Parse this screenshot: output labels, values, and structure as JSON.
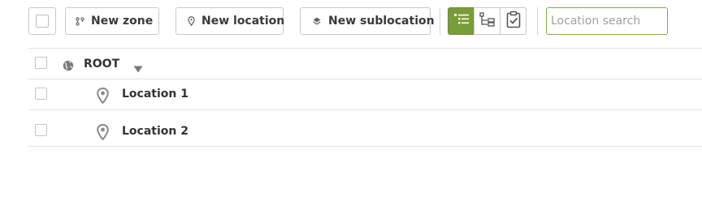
{
  "toolbar": {
    "new_zone_label": "New zone",
    "new_location_label": "New location",
    "new_sublocation_label": "New sublocation",
    "view_modes": [
      {
        "icon": "list-view-icon",
        "active": true
      },
      {
        "icon": "tree-view-icon",
        "active": false
      },
      {
        "icon": "clipboard-check-icon",
        "active": false
      }
    ],
    "search": {
      "value": "",
      "placeholder": "Location search"
    }
  },
  "tree": {
    "root": {
      "label": "ROOT",
      "icon": "globe-icon",
      "expander_icon": "caret-down-icon"
    },
    "locations": [
      {
        "label": "Location 1",
        "icon": "map-pin-icon"
      },
      {
        "label": "Location 2",
        "icon": "map-pin-icon"
      }
    ]
  },
  "colors": {
    "accent": "#7a9b3a",
    "search_border": "#8aaa4a"
  }
}
